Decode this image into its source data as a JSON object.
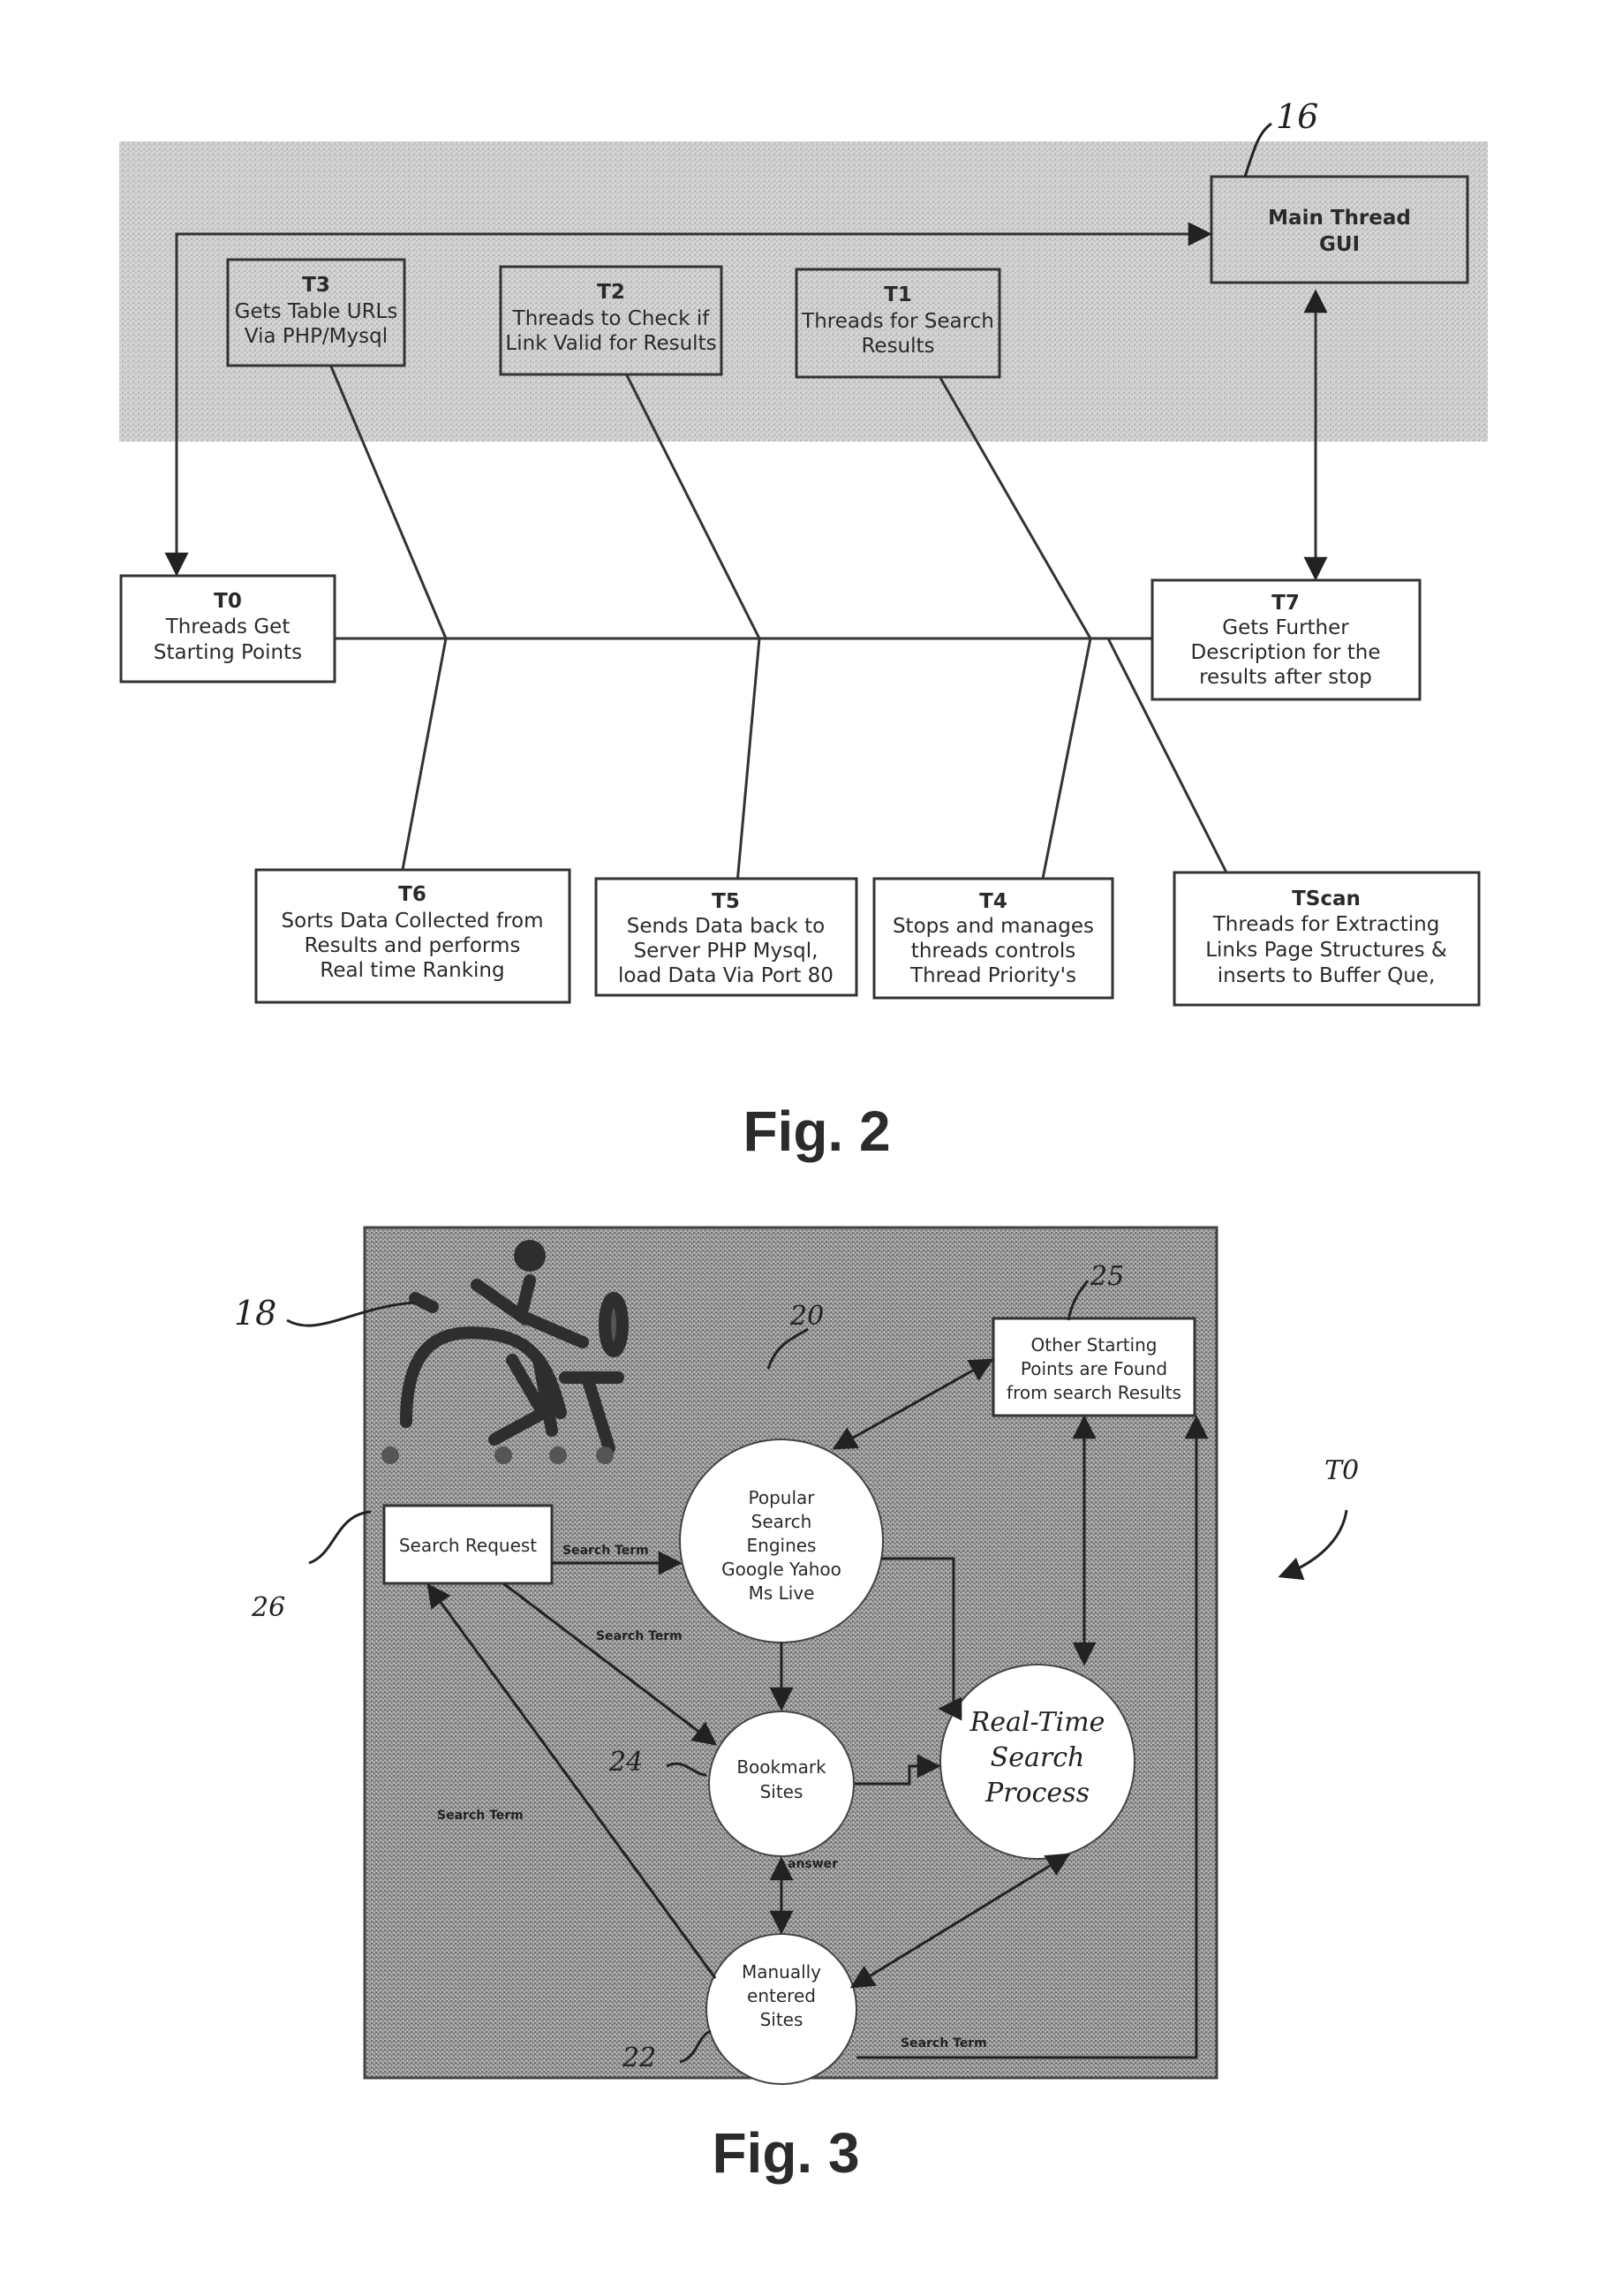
{
  "fig2": {
    "caption": "Fig. 2",
    "ref_main": "16",
    "main_thread": {
      "id": "Main Thread",
      "line2": "GUI"
    },
    "top_boxes": [
      {
        "id": "T3",
        "lines": [
          "Gets Table URLs",
          "Via PHP/Mysql"
        ]
      },
      {
        "id": "T2",
        "lines": [
          "Threads to Check if",
          "Link Valid for Results"
        ]
      },
      {
        "id": "T1",
        "lines": [
          "Threads for Search",
          "Results"
        ]
      }
    ],
    "t0": {
      "id": "T0",
      "lines": [
        "Threads Get",
        "Starting Points"
      ]
    },
    "t7": {
      "id": "T7",
      "lines": [
        "Gets Further",
        "Description for the",
        "results after stop"
      ]
    },
    "bottom_boxes": [
      {
        "id": "T6",
        "lines": [
          "Sorts Data Collected from",
          "Results and performs",
          "Real time Ranking"
        ]
      },
      {
        "id": "T5",
        "lines": [
          "Sends Data back to",
          "Server PHP Mysql,",
          "load Data Via Port 80"
        ]
      },
      {
        "id": "T4",
        "lines": [
          "Stops and manages",
          "threads controls",
          "Thread Priority's"
        ]
      },
      {
        "id": "TScan",
        "lines": [
          "Threads for Extracting",
          "Links Page Structures &",
          "inserts to Buffer Que,"
        ]
      }
    ]
  },
  "fig3": {
    "caption": "Fig. 3",
    "refs": {
      "user": "18",
      "engines": "20",
      "manual": "22",
      "bookmark": "24",
      "other": "25",
      "request": "26",
      "overall": "T0"
    },
    "search_request": "Search Request",
    "other_starting": [
      "Other Starting",
      "Points are Found",
      "from search Results"
    ],
    "engines": [
      "Popular",
      "Search",
      "Engines",
      "Google Yahoo",
      "Ms Live"
    ],
    "bookmark": [
      "Bookmark",
      "Sites"
    ],
    "manual": [
      "Manually",
      "entered",
      "Sites"
    ],
    "realtime": [
      "Real-Time",
      "Search",
      "Process"
    ],
    "edge_labels": {
      "search_term_1": "Search Term",
      "search_term_2": "Search Term",
      "search_term_3": "Search Term",
      "search_term_4": "Search Term",
      "answer": "answer"
    }
  }
}
